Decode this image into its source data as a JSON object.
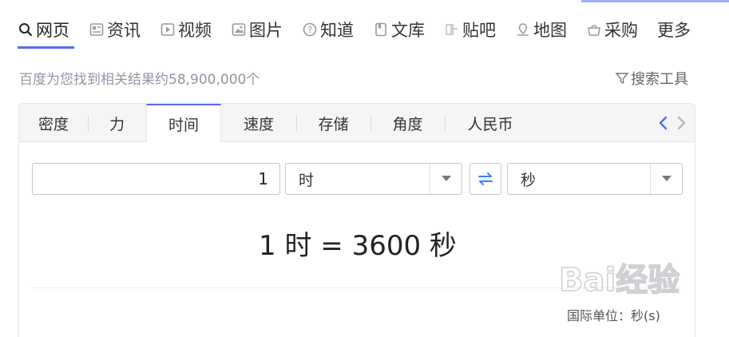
{
  "nav": {
    "items": [
      {
        "label": "网页",
        "icon": "search-icon",
        "active": true
      },
      {
        "label": "资讯",
        "icon": "news-icon"
      },
      {
        "label": "视频",
        "icon": "video-icon"
      },
      {
        "label": "图片",
        "icon": "image-icon"
      },
      {
        "label": "知道",
        "icon": "question-icon"
      },
      {
        "label": "文库",
        "icon": "document-icon"
      },
      {
        "label": "贴吧",
        "icon": "tieba-icon"
      },
      {
        "label": "地图",
        "icon": "map-icon"
      },
      {
        "label": "采购",
        "icon": "shopping-basket-icon"
      },
      {
        "label": "更多",
        "icon": ""
      }
    ]
  },
  "results": {
    "count_text": "百度为您找到相关结果约58,900,000个",
    "search_tools_label": "搜索工具"
  },
  "converter": {
    "tabs": [
      "密度",
      "力",
      "时间",
      "速度",
      "存储",
      "角度",
      "人民币"
    ],
    "active_tab": "时间",
    "input_value": "1",
    "from_unit": "时",
    "to_unit": "秒",
    "result_text": "1 时 = 3600 秒",
    "si_unit_text": "国际单位：秒(s)"
  },
  "watermark": {
    "text": "Bai经验"
  },
  "colors": {
    "accent": "#4e6ef2",
    "muted": "#9195a3",
    "swap": "#3388ff"
  }
}
